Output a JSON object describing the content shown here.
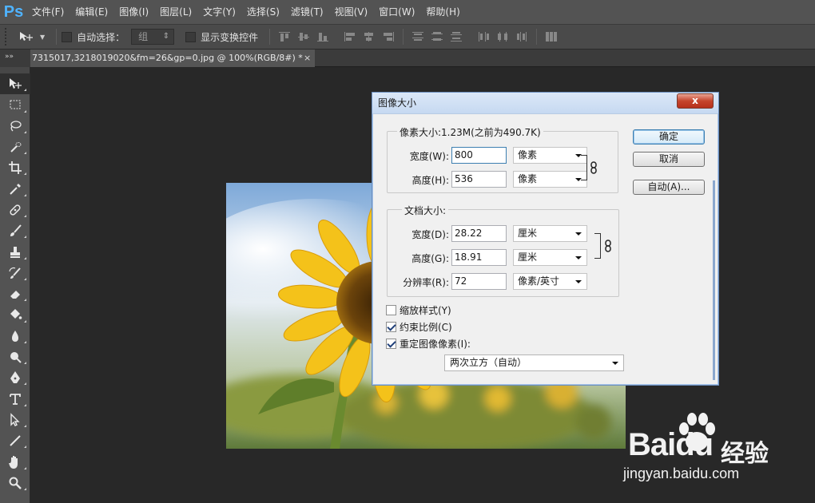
{
  "app": {
    "logo": "Ps"
  },
  "menu": [
    "文件(F)",
    "编辑(E)",
    "图像(I)",
    "图层(L)",
    "文字(Y)",
    "选择(S)",
    "滤镜(T)",
    "视图(V)",
    "窗口(W)",
    "帮助(H)"
  ],
  "options_bar": {
    "tool_icon": "move-tool-icon",
    "auto_select_label": "自动选择：",
    "auto_select_value": "组",
    "show_transform_label": "显示变换控件"
  },
  "document": {
    "tab_title": "7315017,3218019020&fm=26&gp=0.jpg @ 100%(RGB/8#) *",
    "close_glyph": "×",
    "panel_collapse": "»»"
  },
  "toolbox": [
    "move-tool-icon",
    "marquee-tool-icon",
    "lasso-tool-icon",
    "quick-select-tool-icon",
    "crop-tool-icon",
    "eyedropper-tool-icon",
    "healing-brush-tool-icon",
    "brush-tool-icon",
    "clone-stamp-tool-icon",
    "history-brush-tool-icon",
    "eraser-tool-icon",
    "paint-bucket-tool-icon",
    "blur-tool-icon",
    "dodge-tool-icon",
    "pen-tool-icon",
    "type-tool-icon",
    "path-select-tool-icon",
    "line-tool-icon",
    "hand-tool-icon",
    "zoom-tool-icon"
  ],
  "dialog": {
    "title": "图像大小",
    "close_glyph": "x",
    "pixel_group": {
      "legend": "像素大小:1.23M(之前为490.7K)",
      "width_label": "宽度(W):",
      "width_value": "800",
      "width_unit": "像素",
      "height_label": "高度(H):",
      "height_value": "536",
      "height_unit": "像素"
    },
    "doc_group": {
      "legend": "文档大小:",
      "width_label": "宽度(D):",
      "width_value": "28.22",
      "width_unit": "厘米",
      "height_label": "高度(G):",
      "height_value": "18.91",
      "height_unit": "厘米",
      "resolution_label": "分辨率(R):",
      "resolution_value": "72",
      "resolution_unit": "像素/英寸"
    },
    "checkboxes": [
      {
        "label": "缩放样式(Y)",
        "checked": false
      },
      {
        "label": "约束比例(C)",
        "checked": true
      },
      {
        "label": "重定图像像素(I):",
        "checked": true
      }
    ],
    "resample_method": "两次立方（自动）",
    "buttons": {
      "ok": "确定",
      "cancel": "取消",
      "auto": "自动(A)..."
    }
  },
  "watermark": {
    "brand": "Bai",
    "brand_tail": "du",
    "cn": "经验",
    "url": "jingyan.baidu.com"
  },
  "colors": {
    "menubar": "#535353",
    "workspace": "#282828",
    "ps_blue": "#4fb3ff",
    "dialog_bg": "#f0f0f0",
    "close_red": "#c5442c"
  }
}
